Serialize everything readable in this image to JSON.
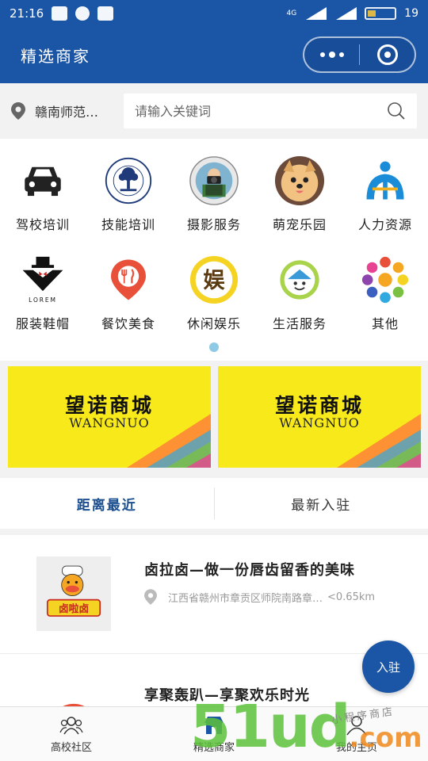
{
  "status_bar": {
    "time": "21:16",
    "network": "4G",
    "battery": "19"
  },
  "header": {
    "title": "精选商家"
  },
  "search": {
    "location": "赣南师范…",
    "placeholder": "请输入关键词"
  },
  "categories": [
    {
      "label": "驾校培训",
      "icon": "car-icon"
    },
    {
      "label": "技能培训",
      "icon": "university-seal-icon"
    },
    {
      "label": "摄影服务",
      "icon": "photographer-icon"
    },
    {
      "label": "萌宠乐园",
      "icon": "puppy-icon"
    },
    {
      "label": "人力资源",
      "icon": "hr-logo-icon"
    },
    {
      "label": "服装鞋帽",
      "icon": "tuxedo-icon",
      "icon_text": "LOREM"
    },
    {
      "label": "餐饮美食",
      "icon": "food-pin-icon"
    },
    {
      "label": "休闲娱乐",
      "icon": "entertainment-icon",
      "icon_text": "娱"
    },
    {
      "label": "生活服务",
      "icon": "life-service-icon"
    },
    {
      "label": "其他",
      "icon": "colorful-circle-icon"
    }
  ],
  "banners": [
    {
      "title": "望诺商城",
      "subtitle": "WANGNUO"
    },
    {
      "title": "望诺商城",
      "subtitle": "WANGNUO"
    }
  ],
  "tabs": [
    {
      "label": "距离最近",
      "active": true
    },
    {
      "label": "最新入驻",
      "active": false
    }
  ],
  "listings": [
    {
      "name": "卤拉卤—做一份唇齿留香的美味",
      "address": "江西省赣州市章贡区师院南路章…",
      "distance": "<0.65km",
      "logo_text": "卤啦卤"
    },
    {
      "name": "享聚轰趴—享聚欢乐时光",
      "address": "",
      "distance": ""
    }
  ],
  "fab": {
    "label": "入驻"
  },
  "bottom_nav": [
    {
      "label": "高校社区",
      "icon": "community-icon"
    },
    {
      "label": "精选商家",
      "icon": "store-icon"
    },
    {
      "label": "我的主页",
      "icon": "profile-icon"
    }
  ],
  "watermark": {
    "text": "51ud",
    "suffix": ".com",
    "tag": "小程序商店"
  },
  "colors": {
    "primary": "#1b55a6",
    "banner_yellow": "#f8ea1a",
    "active_tab": "#1b4f8f"
  }
}
